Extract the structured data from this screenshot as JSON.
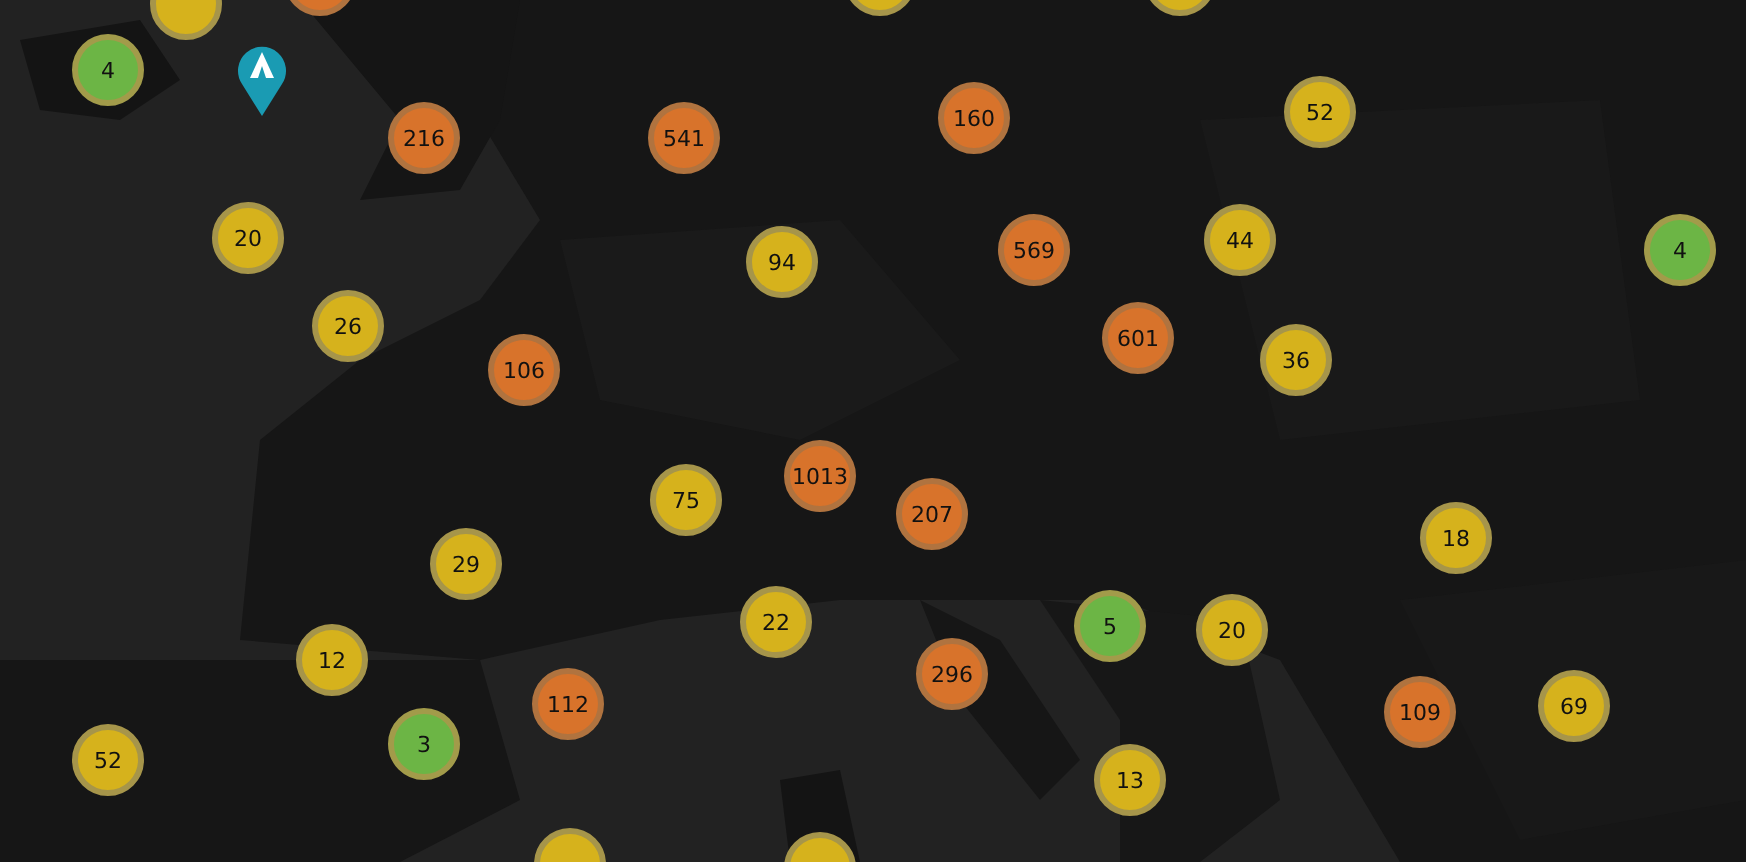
{
  "clusters": [
    {
      "kind": "medium"
    },
    {
      "kind": "large"
    },
    {
      "kind": "medium"
    },
    {
      "kind": "medium"
    },
    {
      "count": "4",
      "kind": "small"
    },
    {
      "count": "216",
      "kind": "large"
    },
    {
      "count": "541",
      "kind": "large"
    },
    {
      "count": "160",
      "kind": "large"
    },
    {
      "count": "52",
      "kind": "medium"
    },
    {
      "count": "20",
      "kind": "medium"
    },
    {
      "count": "94",
      "kind": "medium"
    },
    {
      "count": "569",
      "kind": "large"
    },
    {
      "count": "44",
      "kind": "medium"
    },
    {
      "count": "4",
      "kind": "small"
    },
    {
      "count": "26",
      "kind": "medium"
    },
    {
      "count": "106",
      "kind": "large"
    },
    {
      "count": "601",
      "kind": "large"
    },
    {
      "count": "36",
      "kind": "medium"
    },
    {
      "count": "1013",
      "kind": "large"
    },
    {
      "count": "75",
      "kind": "medium"
    },
    {
      "count": "207",
      "kind": "large"
    },
    {
      "count": "29",
      "kind": "medium"
    },
    {
      "count": "18",
      "kind": "medium"
    },
    {
      "count": "22",
      "kind": "medium"
    },
    {
      "count": "5",
      "kind": "small"
    },
    {
      "count": "20",
      "kind": "medium"
    },
    {
      "count": "12",
      "kind": "medium"
    },
    {
      "count": "296",
      "kind": "large"
    },
    {
      "count": "112",
      "kind": "large"
    },
    {
      "count": "3",
      "kind": "small"
    },
    {
      "count": "52",
      "kind": "medium"
    },
    {
      "count": "109",
      "kind": "large"
    },
    {
      "count": "69",
      "kind": "medium"
    },
    {
      "count": "13",
      "kind": "medium"
    },
    {
      "kind": "medium"
    },
    {
      "kind": "medium"
    }
  ]
}
